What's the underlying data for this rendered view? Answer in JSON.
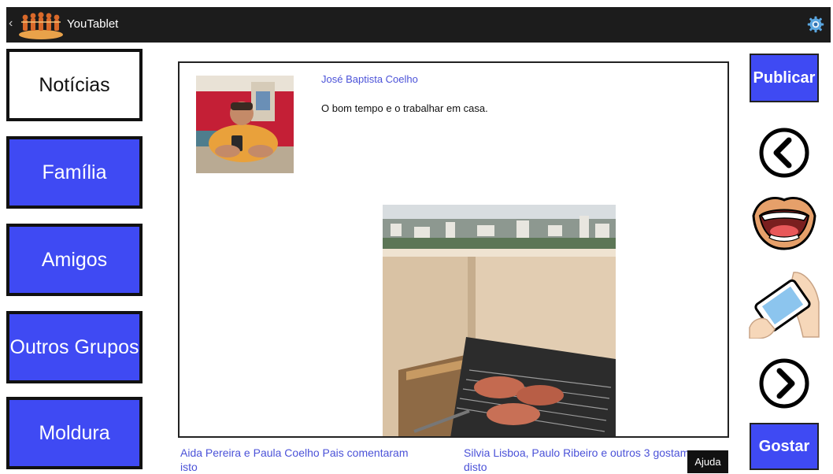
{
  "app": {
    "title": "YouTablet"
  },
  "nav": {
    "items": [
      {
        "label": "Notícias"
      },
      {
        "label": "Família"
      },
      {
        "label": "Amigos"
      },
      {
        "label": "Outros Grupos"
      },
      {
        "label": "Moldura"
      }
    ]
  },
  "post": {
    "author": "José Baptista Coelho",
    "text": "O bom tempo e o trabalhar em casa."
  },
  "footer": {
    "comments": "Aida Pereira e Paula Coelho Pais comentaram isto",
    "likes": "Silvia Lisboa, Paulo Ribeiro e outros 3 gostam disto",
    "help": "Ajuda"
  },
  "actions": {
    "publish": "Publicar",
    "like": "Gostar"
  },
  "colors": {
    "accent": "#3f4af3",
    "topbar": "#1c1c1c",
    "link": "#4b52d8"
  },
  "icons": [
    "back-chevron-icon",
    "youtablet-logo",
    "settings-gear-icon",
    "previous-arrow-icon",
    "speak-mouth-icon",
    "tablet-hands-icon",
    "next-arrow-icon"
  ]
}
